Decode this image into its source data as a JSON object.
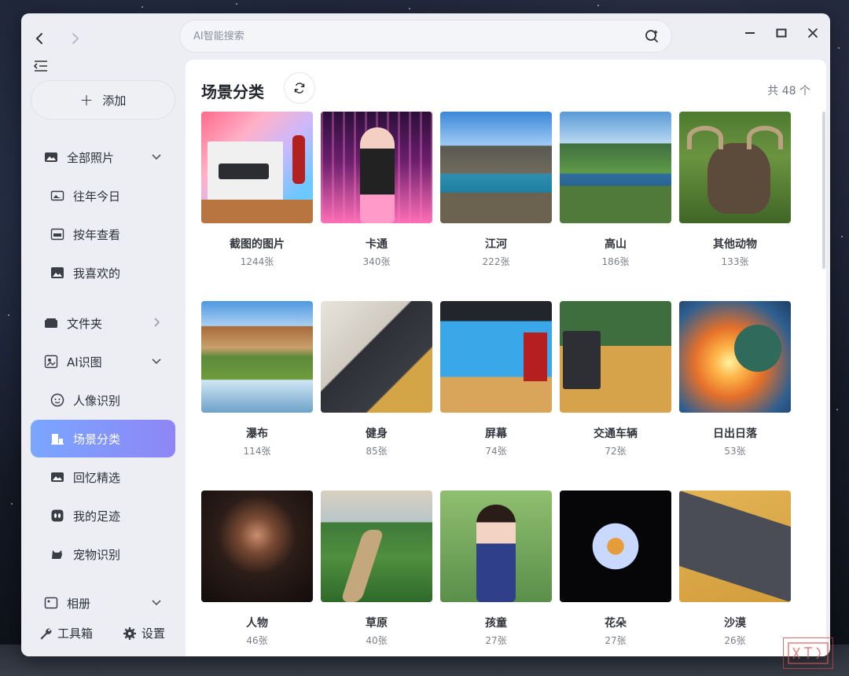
{
  "search": {
    "placeholder": "AI智能搜索"
  },
  "sidebar": {
    "add_label": "添加",
    "items": [
      {
        "label": "全部照片",
        "icon": "photos-icon"
      },
      {
        "label": "往年今日",
        "icon": "history-photo-icon"
      },
      {
        "label": "按年查看",
        "icon": "calendar-365-icon"
      },
      {
        "label": "我喜欢的",
        "icon": "favorite-photo-icon"
      },
      {
        "label": "文件夹",
        "icon": "folder-icon"
      },
      {
        "label": "AI识图",
        "icon": "ai-recognition-icon"
      },
      {
        "label": "人像识别",
        "icon": "face-icon"
      },
      {
        "label": "场景分类",
        "icon": "scene-icon"
      },
      {
        "label": "回忆精选",
        "icon": "memories-icon"
      },
      {
        "label": "我的足迹",
        "icon": "footprint-icon"
      },
      {
        "label": "宠物识别",
        "icon": "pet-icon"
      },
      {
        "label": "相册",
        "icon": "album-icon"
      }
    ],
    "tools_label": "工具箱",
    "settings_label": "设置"
  },
  "main": {
    "title": "场景分类",
    "total": "共 48 个",
    "scenes": [
      {
        "name": "截图的图片",
        "count": "1244张"
      },
      {
        "name": "卡通",
        "count": "340张"
      },
      {
        "name": "江河",
        "count": "222张"
      },
      {
        "name": "高山",
        "count": "186张"
      },
      {
        "name": "其他动物",
        "count": "133张"
      },
      {
        "name": "瀑布",
        "count": "114张"
      },
      {
        "name": "健身",
        "count": "85张"
      },
      {
        "name": "屏幕",
        "count": "74张"
      },
      {
        "name": "交通车辆",
        "count": "72张"
      },
      {
        "name": "日出日落",
        "count": "53张"
      },
      {
        "name": "人物",
        "count": "46张"
      },
      {
        "name": "草原",
        "count": "40张"
      },
      {
        "name": "孩童",
        "count": "27张"
      },
      {
        "name": "花朵",
        "count": "27张"
      },
      {
        "name": "沙漠",
        "count": "26张"
      }
    ]
  },
  "colors": {
    "active_gradient_start": "#7aa6ff",
    "active_gradient_end": "#8e86f6",
    "window_bg": "#eceef3",
    "panel_bg": "#ffffff"
  }
}
